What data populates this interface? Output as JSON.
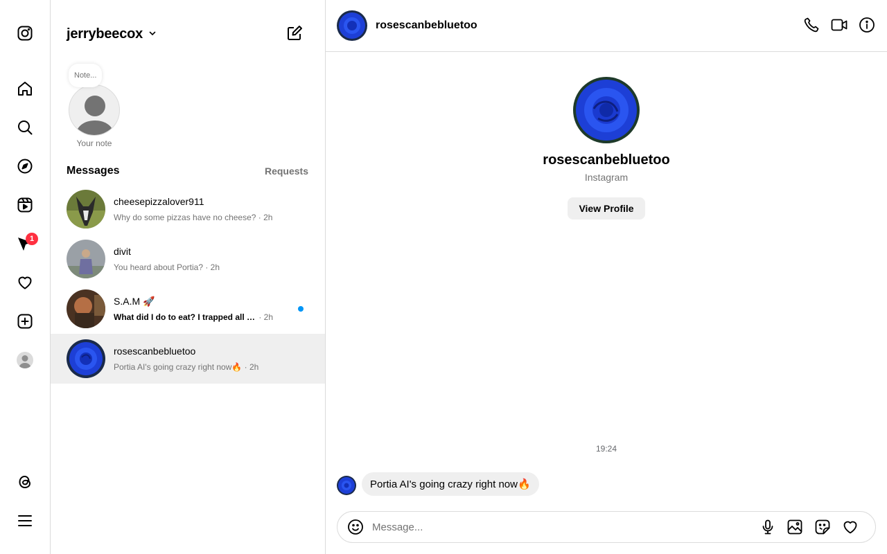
{
  "account": {
    "username": "jerrybeecox"
  },
  "note": {
    "bubble_text": "Note...",
    "label": "Your note"
  },
  "inbox": {
    "title": "Messages",
    "requests_label": "Requests"
  },
  "threads": [
    {
      "name": "cheesepizzalover911",
      "preview": "Why do some pizzas have no cheese?",
      "time": "· 2h",
      "unread": false
    },
    {
      "name": "divit",
      "preview": "You heard about Portia?",
      "time": "· 2h",
      "unread": false
    },
    {
      "name": "S.A.M 🚀",
      "preview": "What did I do to eat? I trapped all m...",
      "time": "· 2h",
      "unread": true
    },
    {
      "name": "rosescanbebluetoo",
      "preview": "Portia AI's going crazy right now🔥",
      "time": "· 2h",
      "unread": false,
      "active": true
    }
  ],
  "rail": {
    "notification_count": "1"
  },
  "conversation": {
    "username": "rosescanbebluetoo",
    "profile_name": "rosescanbebluetoo",
    "profile_sub": "Instagram",
    "view_profile_label": "View Profile",
    "timestamp": "19:24",
    "messages": [
      {
        "text": "Portia AI's going crazy right now🔥"
      }
    ],
    "composer_placeholder": "Message..."
  },
  "colors": {
    "accent": "#0095f6",
    "badge": "#ff3040",
    "border": "#dbdbdb",
    "muted": "#737373",
    "bubble": "#efefef"
  }
}
